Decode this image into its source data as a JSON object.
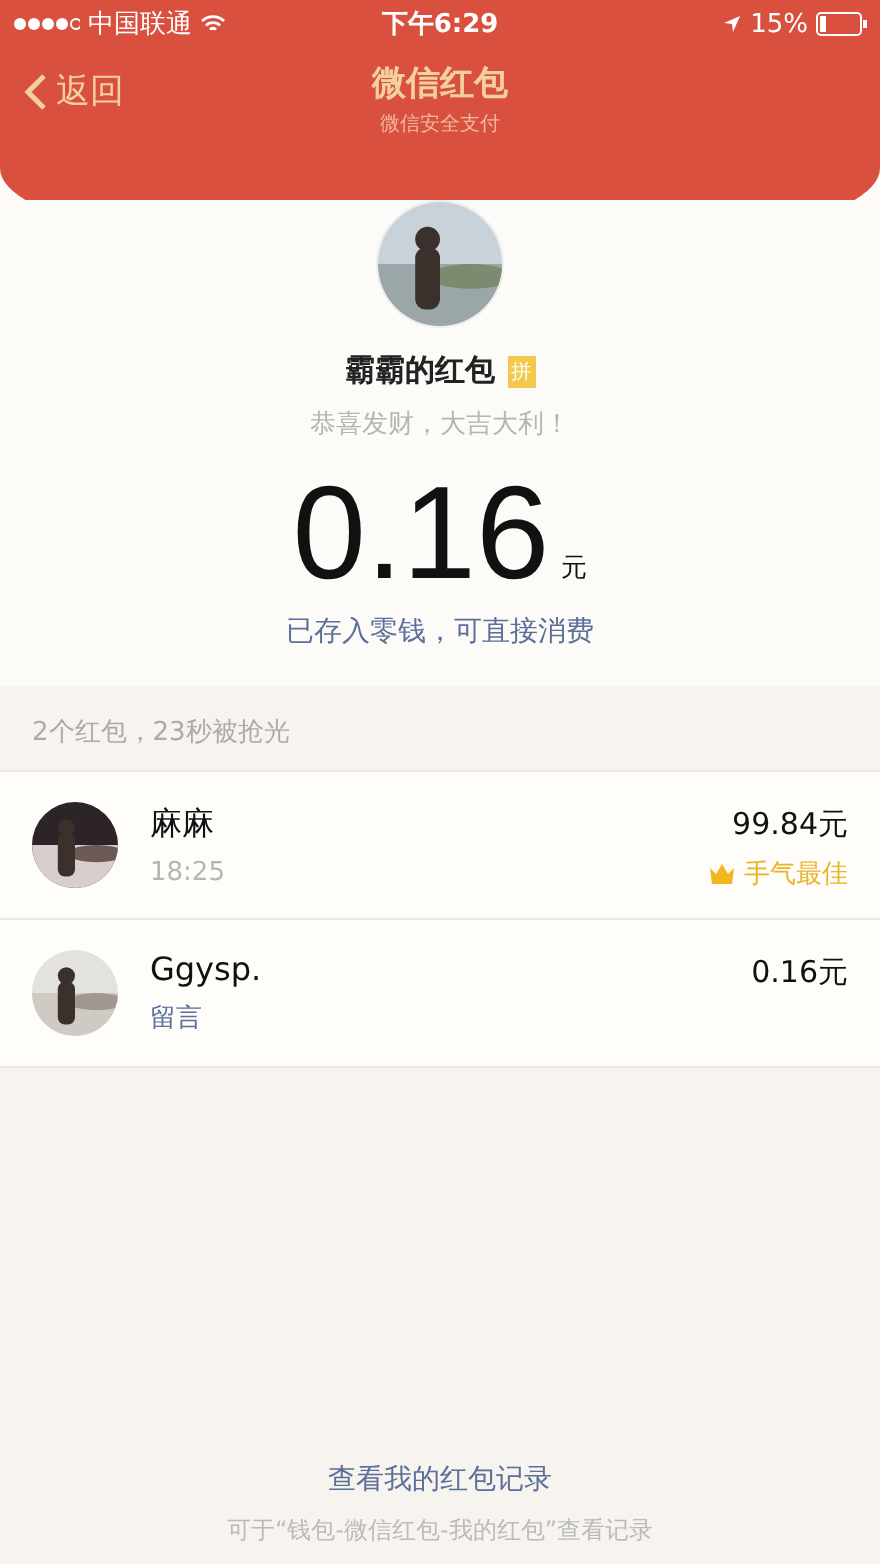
{
  "status_bar": {
    "carrier": "中国联通",
    "time": "下午6:29",
    "battery": "15%"
  },
  "nav": {
    "back": "返回",
    "title": "微信红包",
    "subtitle": "微信安全支付"
  },
  "packet": {
    "sender": "霸霸的红包",
    "badge": "拼",
    "greeting": "恭喜发财，大吉大利！",
    "amount": "0.16",
    "unit": "元",
    "note": "已存入零钱，可直接消费"
  },
  "summary": "2个红包，23秒被抢光",
  "rows": [
    {
      "name": "麻麻",
      "kind": "time",
      "detail": "18:25",
      "amount": "99.84元",
      "best": true,
      "best_label": "手气最佳"
    },
    {
      "name": "Ggysp.",
      "kind": "message",
      "detail": "留言",
      "amount": "0.16元",
      "best": false
    }
  ],
  "footer": {
    "link": "查看我的红包记录",
    "note": "可于“钱包-微信红包-我的红包”查看记录"
  }
}
